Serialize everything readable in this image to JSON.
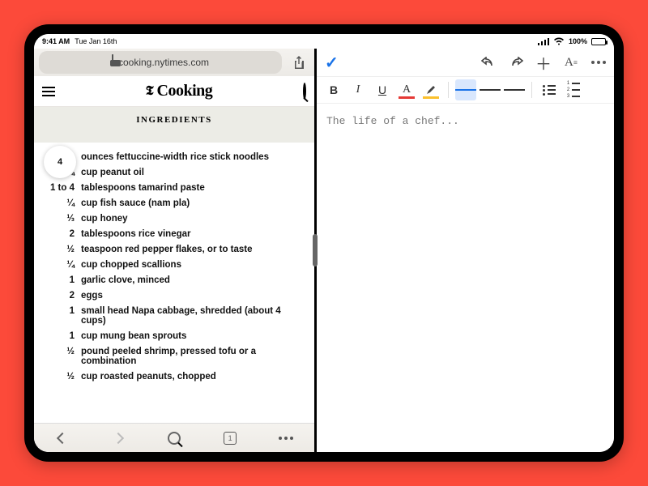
{
  "status": {
    "time": "9:41 AM",
    "date": "Tue Jan 16th",
    "battery_pct": "100%"
  },
  "safari": {
    "url_display": "cooking.nytimes.com",
    "site_brand_suffix": "Cooking",
    "tab_count": "1"
  },
  "recipe": {
    "section_title": "INGREDIENTS",
    "highlight_qty": "4",
    "ingredients": [
      {
        "qty": "4",
        "item": "ounces fettuccine-width rice stick noodles"
      },
      {
        "qty": "¼",
        "item": "cup peanut oil"
      },
      {
        "qty": "1 to 4",
        "item": "tablespoons tamarind paste"
      },
      {
        "qty": "¼",
        "item": "cup fish sauce (nam pla)"
      },
      {
        "qty": "⅓",
        "item": "cup honey"
      },
      {
        "qty": "2",
        "item": "tablespoons rice vinegar"
      },
      {
        "qty": "½",
        "item": "teaspoon red pepper flakes, or to taste"
      },
      {
        "qty": "¼",
        "item": "cup chopped scallions"
      },
      {
        "qty": "1",
        "item": "garlic clove, minced"
      },
      {
        "qty": "2",
        "item": "eggs"
      },
      {
        "qty": "1",
        "item": "small head Napa cabbage, shredded (about 4 cups)"
      },
      {
        "qty": "1",
        "item": "cup mung bean sprouts"
      },
      {
        "qty": "½",
        "item": "pound peeled shrimp, pressed tofu or a combination"
      },
      {
        "qty": "½",
        "item": "cup roasted peanuts, chopped"
      }
    ]
  },
  "editor": {
    "body_text": "The life of a chef...",
    "text_color_swatch": "#e53935",
    "highlight_swatch": "#fbc02d"
  }
}
